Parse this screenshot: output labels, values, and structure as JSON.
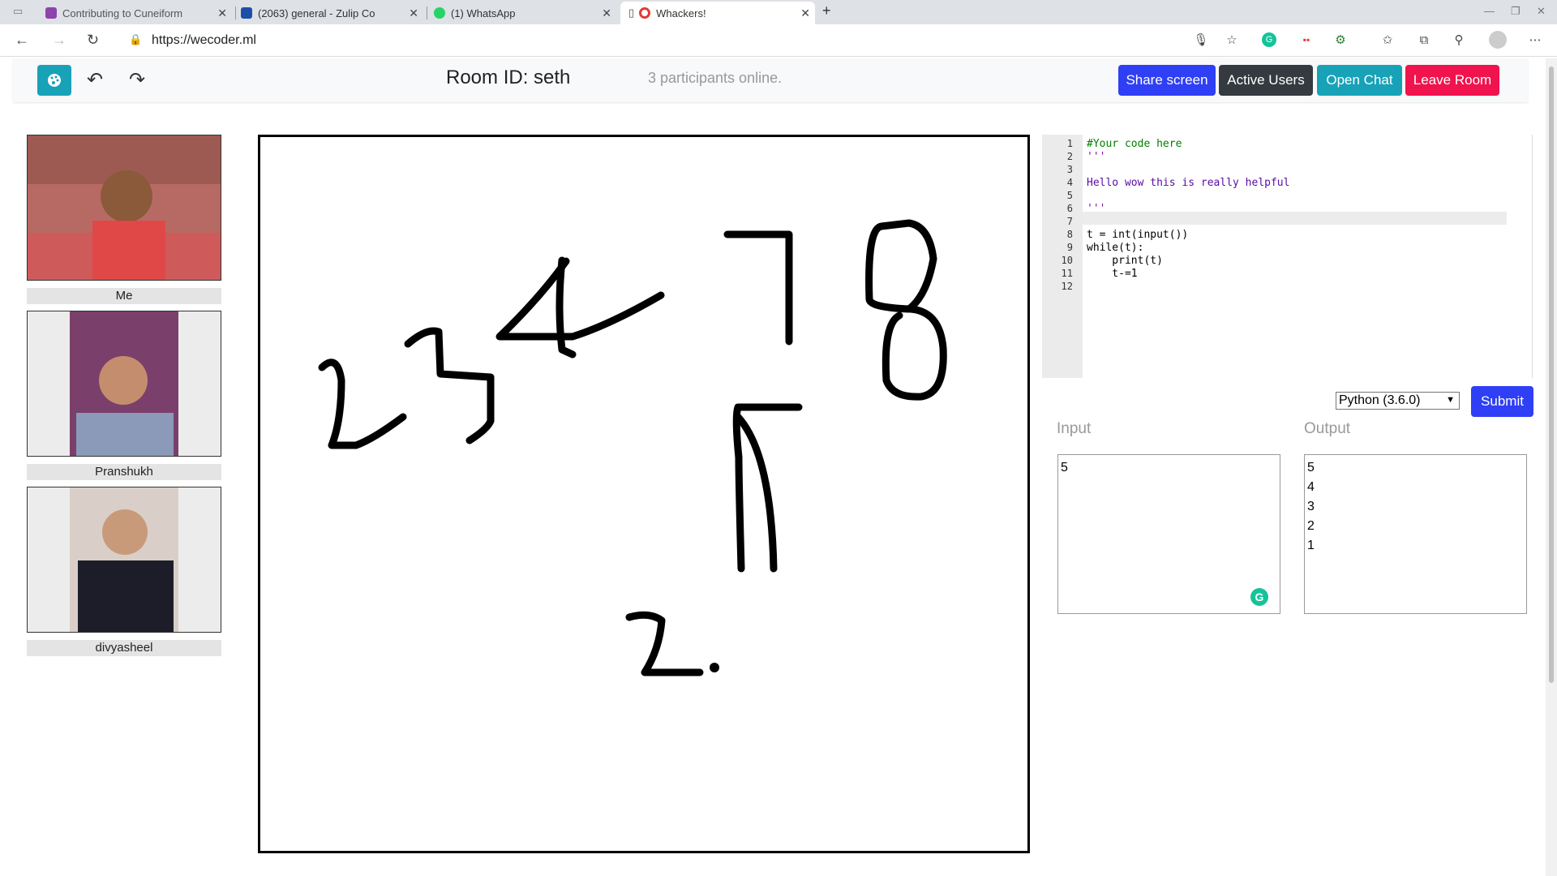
{
  "browser": {
    "tabs": [
      {
        "label": "Contributing to Cuneiform",
        "icon_color": "#8e44ad"
      },
      {
        "label": "(2063) general - Zulip Co",
        "icon_color": "#1e4fa8"
      },
      {
        "label": "(1) WhatsApp",
        "icon_color": "#25d366"
      },
      {
        "label": "Whackers!",
        "icon_color": "#e53935"
      }
    ],
    "new_tab": "+",
    "url": "https://wecoder.ml"
  },
  "header": {
    "room_id": "Room ID: seth",
    "online_text": "3 participants online.",
    "buttons": {
      "share": "Share screen",
      "active_users": "Active Users",
      "open_chat": "Open Chat",
      "leave": "Leave Room"
    },
    "colors": {
      "share": "#2f3ff5",
      "active_users": "#343a40",
      "open_chat": "#17a2b8",
      "leave": "#f0134d"
    }
  },
  "participants": [
    {
      "name": "Me"
    },
    {
      "name": "Pranshukh"
    },
    {
      "name": "divyasheel"
    }
  ],
  "editor": {
    "lines": [
      {
        "n": "1",
        "text": "#Your code here",
        "color": "#008000"
      },
      {
        "n": "2",
        "text": "'''",
        "color": "#7a0ba5"
      },
      {
        "n": "3",
        "text": "",
        "color": "#7a0ba5"
      },
      {
        "n": "4",
        "text": "Hello wow this is really helpful",
        "color": "#5a0ba5"
      },
      {
        "n": "5",
        "text": "",
        "color": "#7a0ba5"
      },
      {
        "n": "6",
        "text": "'''",
        "color": "#7a0ba5"
      },
      {
        "n": "7",
        "text": "",
        "color": "#000"
      },
      {
        "n": "8",
        "text": "t = int(input())",
        "color": "#000"
      },
      {
        "n": "9",
        "text": "while(t):",
        "color": "#000"
      },
      {
        "n": "10",
        "text": "    print(t)",
        "color": "#000"
      },
      {
        "n": "11",
        "text": "    t-=1",
        "color": "#000"
      },
      {
        "n": "12",
        "text": "",
        "color": "#000"
      }
    ]
  },
  "language_select": {
    "selected": "Python (3.6.0)"
  },
  "submit_label": "Submit",
  "io": {
    "input_label": "Input",
    "output_label": "Output",
    "input_value": "5",
    "output_lines": [
      "5",
      "4",
      "3",
      "2",
      "1"
    ]
  }
}
